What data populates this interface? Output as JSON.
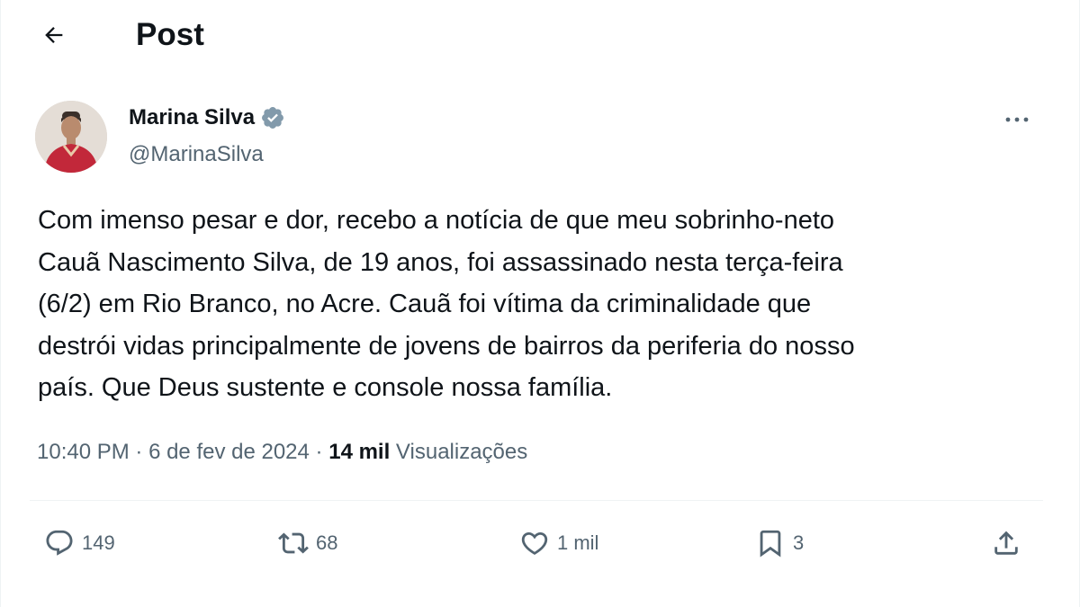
{
  "header": {
    "title": "Post"
  },
  "author": {
    "name": "Marina Silva",
    "handle": "@MarinaSilva",
    "verified": true
  },
  "post": {
    "text": "Com imenso pesar e dor, recebo a notícia de que meu sobrinho-neto\nCauã Nascimento Silva, de 19 anos, foi assassinado nesta terça-feira\n(6/2) em Rio Branco, no Acre. Cauã foi vítima da criminalidade que\ndestrói vidas principalmente de jovens de bairros da periferia do nosso\npaís. Que Deus sustente e console nossa família.",
    "time": "10:40 PM",
    "separator": " · ",
    "date": "6 de fev de 2024",
    "views_count": "14 mil",
    "views_label": " Visualizações"
  },
  "actions": {
    "replies": "149",
    "reposts": "68",
    "likes": "1 mil",
    "bookmarks": "3"
  },
  "icons": {
    "back": "arrow-left-icon",
    "verified": "verified-badge-icon",
    "more": "more-horizontal-icon",
    "reply": "reply-icon",
    "repost": "repost-icon",
    "like": "heart-icon",
    "bookmark": "bookmark-icon",
    "share": "share-icon"
  },
  "colors": {
    "text_primary": "#0f1419",
    "text_secondary": "#536471",
    "verified_badge": "#829aab",
    "divider": "#eff3f4"
  }
}
